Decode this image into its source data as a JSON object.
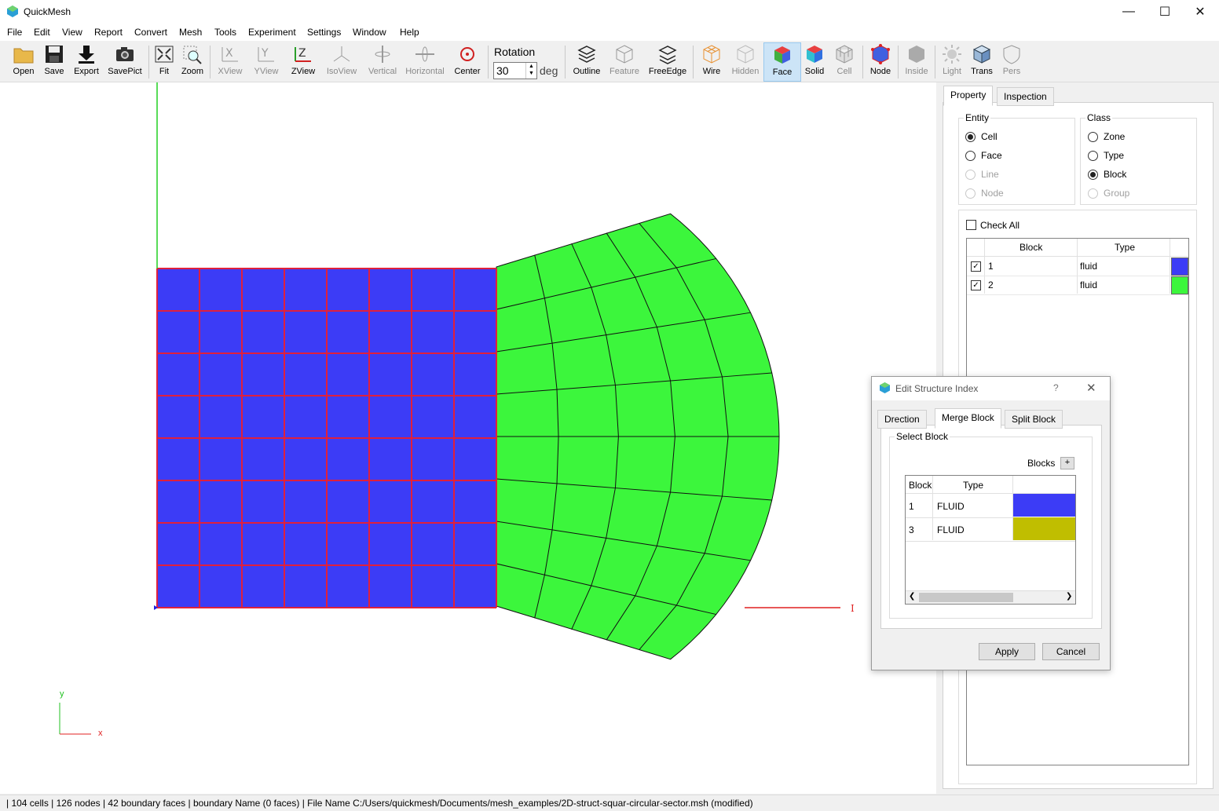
{
  "app": {
    "title": "QuickMesh"
  },
  "menu": [
    "File",
    "Edit",
    "View",
    "Report",
    "Convert",
    "Mesh",
    "Tools",
    "Experiment",
    "Settings",
    "Window",
    "Help"
  ],
  "toolbar": {
    "open": "Open",
    "save": "Save",
    "export": "Export",
    "savepict": "SavePict",
    "fit": "Fit",
    "zoom": "Zoom",
    "xview": "XView",
    "yview": "YView",
    "zview": "ZView",
    "isoview": "IsoView",
    "vertical": "Vertical",
    "horizontal": "Horizontal",
    "center": "Center",
    "rotation_label": "Rotation",
    "rotation_value": "30",
    "rotation_unit": "deg",
    "outline": "Outline",
    "feature": "Feature",
    "freeedge": "FreeEdge",
    "wire": "Wire",
    "hidden": "Hidden",
    "face": "Face",
    "solid": "Solid",
    "cell": "Cell",
    "node": "Node",
    "inside": "Inside",
    "light": "Light",
    "trans": "Trans",
    "pers": "Pers"
  },
  "viewport": {
    "axis_y": "y",
    "axis_x": "x",
    "axis_i": "I"
  },
  "panel": {
    "tabs": [
      "Property",
      "Inspection"
    ],
    "entity": {
      "label": "Entity",
      "options": [
        "Cell",
        "Face",
        "Line",
        "Node"
      ]
    },
    "class": {
      "label": "Class",
      "options": [
        "Zone",
        "Type",
        "Block",
        "Group"
      ]
    },
    "check_all": "Check All",
    "table": {
      "headers": [
        "Block",
        "Type"
      ],
      "rows": [
        {
          "block": "1",
          "type": "fluid"
        },
        {
          "block": "2",
          "type": "fluid"
        }
      ]
    }
  },
  "colors": {
    "block1": "#3c3cf6",
    "block2": "#3cf63c",
    "block3": "#c0be00",
    "mesh_edge": "#e0203c"
  },
  "dialog": {
    "title": "Edit Structure Index",
    "help": "?",
    "tabs": [
      "Drection",
      "Merge Block",
      "Split Block"
    ],
    "group_label": "Select Block",
    "blocks_label": "Blocks",
    "add": "+",
    "headers": [
      "Block",
      "Type"
    ],
    "rows": [
      {
        "block": "1",
        "type": "FLUID"
      },
      {
        "block": "3",
        "type": "FLUID"
      }
    ],
    "apply": "Apply",
    "cancel": "Cancel"
  },
  "status": "| 104 cells | 126 nodes | 42 boundary faces |  boundary Name  (0 faces) | File Name C:/Users/quickmesh/Documents/mesh_examples/2D-struct-squar-circular-sector.msh (modified)"
}
